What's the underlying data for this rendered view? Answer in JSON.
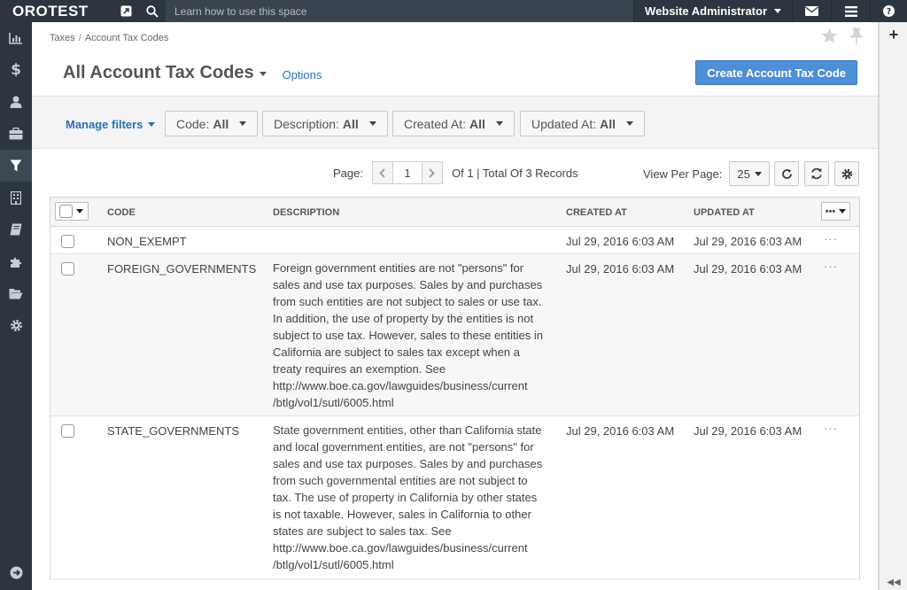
{
  "topbar": {
    "logo": "OROTEST",
    "search_placeholder": "Learn how to use this space",
    "user_name": "Website Administrator"
  },
  "breadcrumb": [
    "Taxes",
    "Account Tax Codes"
  ],
  "page": {
    "title": "All Account Tax Codes",
    "options_label": "Options",
    "create_button": "Create Account Tax Code"
  },
  "filters": {
    "manage_label": "Manage filters",
    "items": [
      {
        "name": "Code:",
        "value": "All"
      },
      {
        "name": "Description:",
        "value": "All"
      },
      {
        "name": "Created At:",
        "value": "All"
      },
      {
        "name": "Updated At:",
        "value": "All"
      }
    ]
  },
  "pager": {
    "page_label": "Page:",
    "current_page": "1",
    "total_text": "Of 1 | Total Of 3 Records",
    "per_page_label": "View Per Page:",
    "per_page_value": "25"
  },
  "grid": {
    "columns": [
      "CODE",
      "DESCRIPTION",
      "CREATED AT",
      "UPDATED AT"
    ],
    "rows": [
      {
        "code": "NON_EXEMPT",
        "description": [],
        "created_at": "Jul 29, 2016 6:03 AM",
        "updated_at": "Jul 29, 2016 6:03 AM"
      },
      {
        "code": "FOREIGN_GOVERNMENTS",
        "description": [
          "Foreign government entities are not \"persons\" for",
          "sales and use tax purposes. Sales by and purchases",
          "from such entities are not subject to sales or use tax.",
          "In addition, the use of property by the entities is not",
          "subject to use tax. However, sales to these entities in",
          "California are subject to sales tax except when a",
          "treaty requires an exemption. See",
          "http://www.boe.ca.gov/lawguides/business/current",
          "/btlg/vol1/sutl/6005.html"
        ],
        "created_at": "Jul 29, 2016 6:03 AM",
        "updated_at": "Jul 29, 2016 6:03 AM"
      },
      {
        "code": "STATE_GOVERNMENTS",
        "description": [
          "State government entities, other than California state",
          "and local government entities, are not \"persons\" for",
          "sales and use tax purposes. Sales by and purchases",
          "from such governmental entities are not subject to",
          "tax. The use of property in California by other states",
          "is not taxable. However, sales in California to other",
          "states are subject to sales tax. See",
          "http://www.boe.ca.gov/lawguides/business/current",
          "/btlg/vol1/sutl/6005.html"
        ],
        "created_at": "Jul 29, 2016 6:03 AM",
        "updated_at": "Jul 29, 2016 6:03 AM"
      }
    ]
  },
  "colors": {
    "topbar_bg": "#2c3540",
    "link": "#2a6fb8",
    "primary_button": "#4f8fd8"
  }
}
